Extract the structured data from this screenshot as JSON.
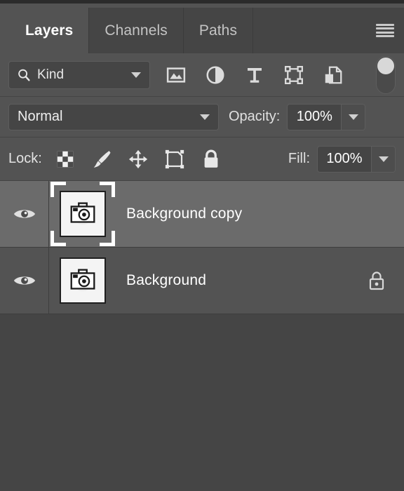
{
  "panel": {
    "title": "Layers",
    "tabs": [
      {
        "label": "Layers",
        "active": true
      },
      {
        "label": "Channels",
        "active": false
      },
      {
        "label": "Paths",
        "active": false
      }
    ],
    "menu_icon": "hamburger-menu-icon"
  },
  "filter": {
    "kind_label": "Kind",
    "search_icon": "search-icon",
    "dropdown_icon": "chevron-down-icon",
    "icons": [
      {
        "name": "pixel-layer-filter-icon",
        "title": "Filter for pixel layers"
      },
      {
        "name": "adjustment-layer-filter-icon",
        "title": "Filter for adjustment layers"
      },
      {
        "name": "type-layer-filter-icon",
        "title": "Filter for type layers"
      },
      {
        "name": "shape-layer-filter-icon",
        "title": "Filter for shape layers"
      },
      {
        "name": "smart-object-filter-icon",
        "title": "Filter for smart objects"
      }
    ],
    "toggle": {
      "name": "filter-enable-toggle",
      "state": "off"
    }
  },
  "blend": {
    "mode": "Normal",
    "opacity_label": "Opacity:",
    "opacity_value": "100%",
    "stepper_icon": "chevron-down-icon"
  },
  "lock": {
    "label": "Lock:",
    "icons": [
      {
        "name": "lock-transparent-pixels-icon"
      },
      {
        "name": "lock-image-pixels-icon"
      },
      {
        "name": "lock-position-icon"
      },
      {
        "name": "lock-artboard-nesting-icon"
      },
      {
        "name": "lock-all-icon"
      }
    ],
    "fill_label": "Fill:",
    "fill_value": "100%",
    "stepper_icon": "chevron-down-icon"
  },
  "layers": [
    {
      "name": "Background copy",
      "selected": true,
      "visible": true,
      "locked": false,
      "thumbnail": "camera-photo-thumbnail",
      "visibility_icon": "eye-icon"
    },
    {
      "name": "Background",
      "selected": false,
      "visible": true,
      "locked": true,
      "thumbnail": "camera-photo-thumbnail",
      "visibility_icon": "eye-icon",
      "lock_icon": "padlock-icon"
    }
  ],
  "colors": {
    "panel_bg": "#535353",
    "tab_inactive": "#454545",
    "row_selected": "#6b6b6b",
    "list_bg": "#454545",
    "text": "#ffffff"
  }
}
